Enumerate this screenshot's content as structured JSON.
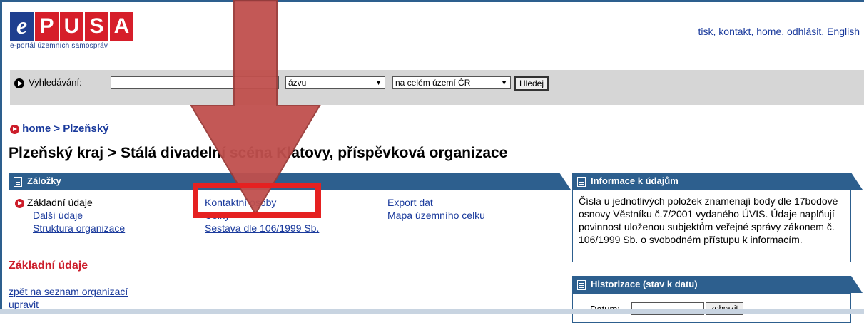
{
  "logo": {
    "letters": [
      "e",
      "P",
      "U",
      "S",
      "A"
    ],
    "subtitle": "e-portál územních samospráv"
  },
  "toplinks": [
    "tisk",
    "kontakt",
    "home",
    "odhlásit",
    "English"
  ],
  "search": {
    "label": "Vyhledávání:",
    "input_value": "",
    "select_type": "ázvu",
    "select_scope": "na celém území ČR",
    "button": "Hledej"
  },
  "breadcrumb": {
    "home": "home",
    "sep": ">",
    "region": "Plzeňský"
  },
  "page_title": "Plzeňský kraj > Stálá divadelní scéna Klatovy, příspěvková organizace",
  "zalozky": {
    "title": "Záložky",
    "col1": [
      "Základní údaje",
      "Další údaje",
      "Struktura organizace"
    ],
    "col2": [
      "Kontaktní osoby",
      "Celky",
      "Sestava dle 106/1999 Sb."
    ],
    "col3": [
      "Export dat",
      "Mapa územního celku"
    ]
  },
  "info": {
    "title": "Informace k údajům",
    "text": "Čísla u jednotlivých položek znamenají body dle 17bodové osnovy Věstníku č.7/2001 vydaného ÚVIS. Údaje naplňují povinnost uloženou subjektům veřejné správy zákonem č. 106/1999 Sb. o svobodném přístupu k informacím."
  },
  "hist": {
    "title": "Historizace (stav k datu)",
    "label": "Datum:",
    "button": "zobrazit"
  },
  "section": {
    "title": "Základní údaje",
    "links": [
      "zpět na seznam organizací",
      "upravit"
    ]
  },
  "annotation_color": "#e52121"
}
